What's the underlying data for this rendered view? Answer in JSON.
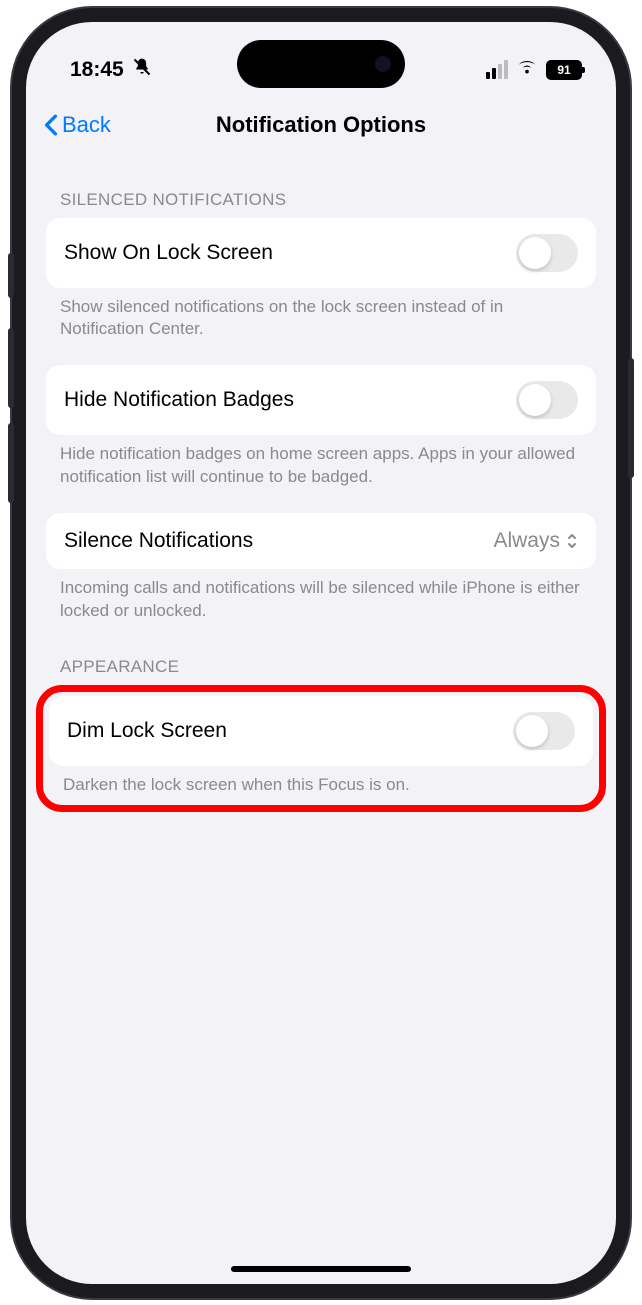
{
  "status": {
    "time": "18:45",
    "battery": "91"
  },
  "nav": {
    "back": "Back",
    "title": "Notification Options"
  },
  "sections": {
    "silenced": {
      "header": "Silenced Notifications",
      "showLock": {
        "label": "Show On Lock Screen",
        "footer": "Show silenced notifications on the lock screen instead of in Notification Center."
      },
      "hideBadges": {
        "label": "Hide Notification Badges",
        "footer": "Hide notification badges on home screen apps. Apps in your allowed notification list will continue to be badged."
      },
      "silence": {
        "label": "Silence Notifications",
        "value": "Always",
        "footer": "Incoming calls and notifications will be silenced while iPhone is either locked or unlocked."
      }
    },
    "appearance": {
      "header": "Appearance",
      "dim": {
        "label": "Dim Lock Screen",
        "footer": "Darken the lock screen when this Focus is on."
      }
    }
  }
}
